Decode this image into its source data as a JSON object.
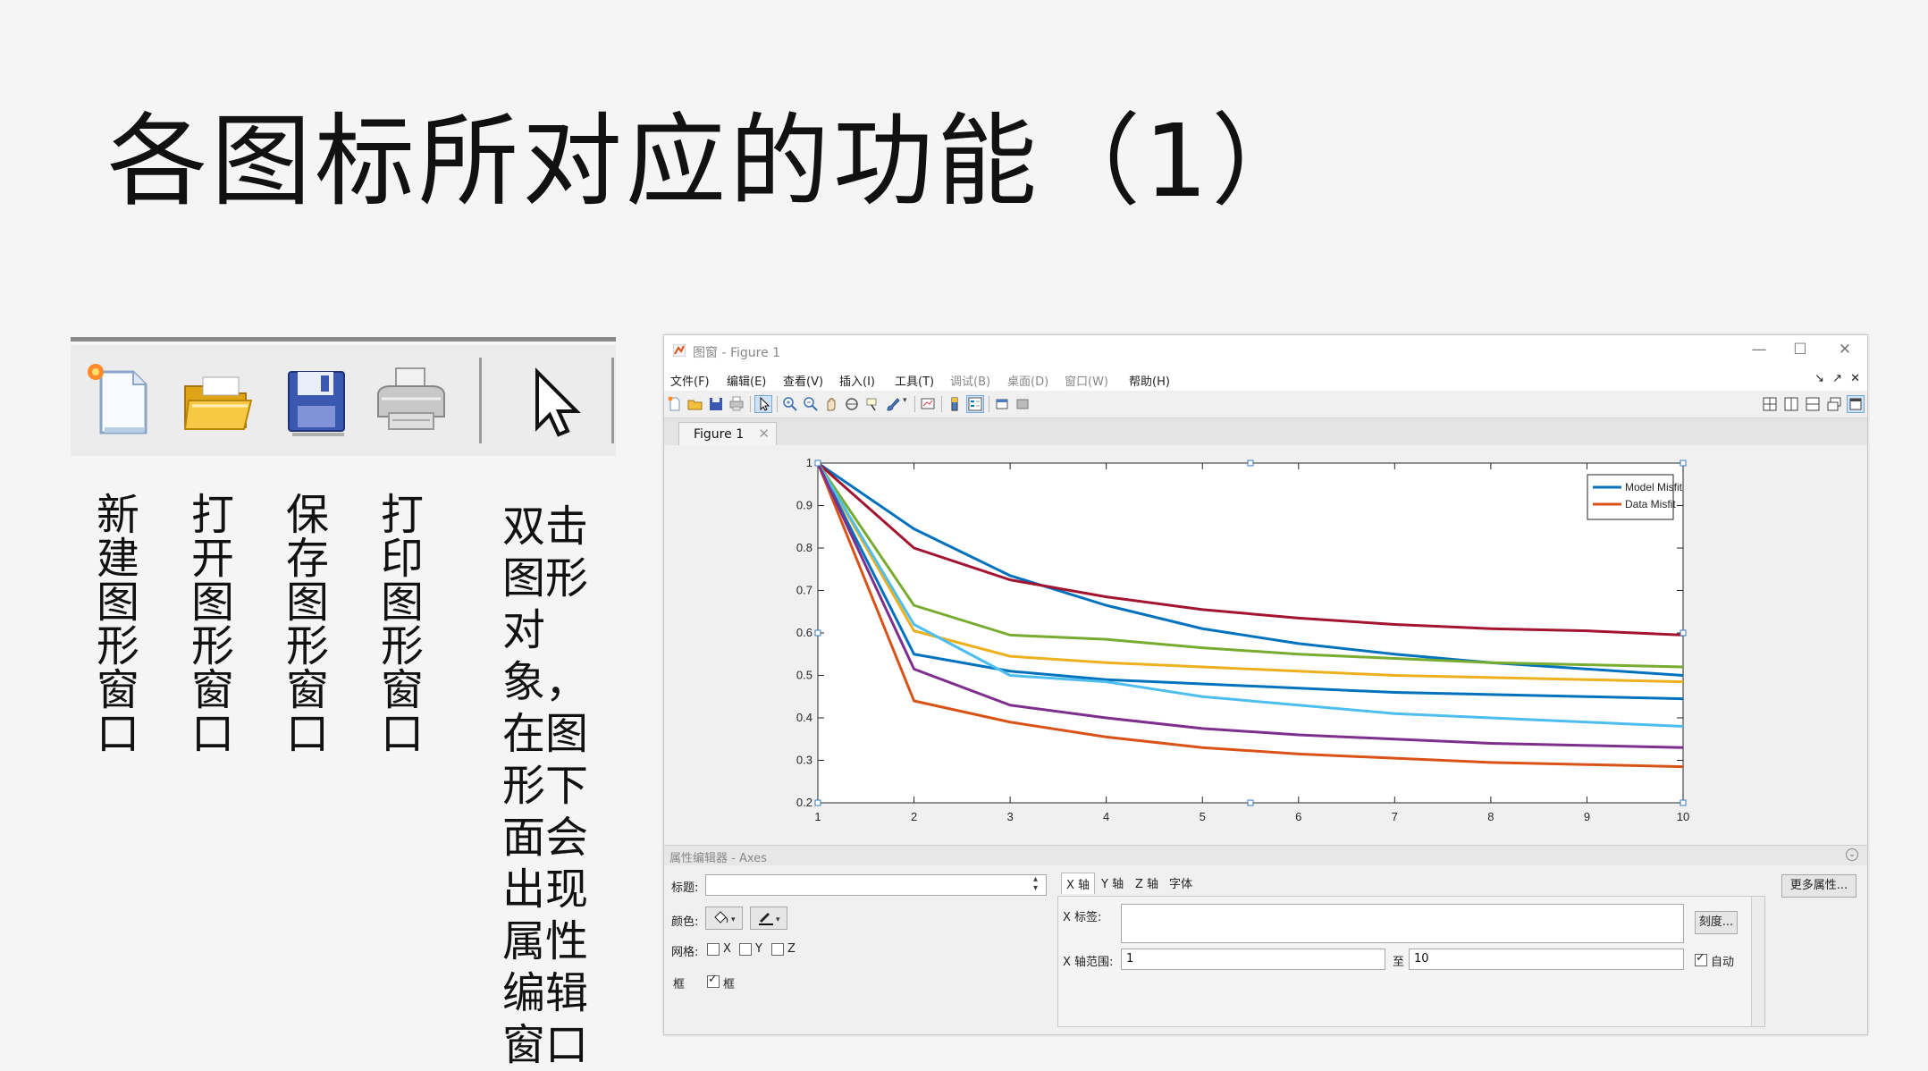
{
  "slide": {
    "title": "各图标所对应的功能（1）",
    "icon_captions": [
      "新建图形窗口",
      "打开图形窗口",
      "保存图形窗口",
      "打印图形窗口"
    ],
    "pointer_description": "双击图形对象，在图形下面会出现属性编辑窗口"
  },
  "big_toolbar": {
    "icons": [
      "new-figure-icon",
      "open-folder-icon",
      "save-floppy-icon",
      "printer-icon",
      "pointer-arrow-icon"
    ]
  },
  "figure_window": {
    "title": "图窗 - Figure 1",
    "window_controls": [
      "—",
      "☐",
      "✕"
    ],
    "menu": [
      "文件(F)",
      "编辑(E)",
      "查看(V)",
      "插入(I)",
      "工具(T)",
      "调试(B)",
      "桌面(D)",
      "窗口(W)",
      "帮助(H)"
    ],
    "menu_right_icons": [
      "↘",
      "↗",
      "✕"
    ],
    "tab_label": "Figure 1",
    "tab_close": "✕"
  },
  "colors": {
    "model_misfit": "#0072bd",
    "data_misfit": "#d95319",
    "yellow": "#edb120",
    "purple": "#7e2f8e",
    "green": "#77ac30",
    "lightblue": "#4dbeee",
    "darkred": "#a2142f"
  },
  "chart_data": {
    "type": "line",
    "x": [
      1,
      2,
      3,
      4,
      5,
      6,
      7,
      8,
      9,
      10
    ],
    "xlim": [
      1,
      10
    ],
    "ylim": [
      0.2,
      1
    ],
    "xticks": [
      1,
      2,
      3,
      4,
      5,
      6,
      7,
      8,
      9,
      10
    ],
    "yticks": [
      0.2,
      0.3,
      0.4,
      0.5,
      0.6,
      0.7,
      0.8,
      0.9,
      1
    ],
    "legend_position": "top-right",
    "grid": false,
    "series": [
      {
        "name": "Model Misfit",
        "color": "#0072bd",
        "values": [
          1,
          0.845,
          0.735,
          0.665,
          0.61,
          0.575,
          0.55,
          0.53,
          0.515,
          0.5
        ]
      },
      {
        "name": "Data Misfit",
        "color": "#d95319",
        "values": [
          1,
          0.44,
          0.39,
          0.355,
          0.33,
          0.315,
          0.305,
          0.295,
          0.29,
          0.285
        ]
      },
      {
        "color": "#a2142f",
        "values": [
          1,
          0.8,
          0.725,
          0.685,
          0.655,
          0.635,
          0.62,
          0.61,
          0.605,
          0.595
        ]
      },
      {
        "color": "#77ac30",
        "values": [
          1,
          0.665,
          0.595,
          0.585,
          0.565,
          0.55,
          0.54,
          0.53,
          0.525,
          0.52
        ]
      },
      {
        "color": "#edb120",
        "values": [
          1,
          0.605,
          0.545,
          0.53,
          0.52,
          0.51,
          0.5,
          0.495,
          0.49,
          0.485
        ]
      },
      {
        "color": "#0072bd",
        "values": [
          1,
          0.55,
          0.51,
          0.49,
          0.48,
          0.47,
          0.46,
          0.455,
          0.45,
          0.445
        ]
      },
      {
        "color": "#4dbeee",
        "values": [
          1,
          0.62,
          0.5,
          0.485,
          0.45,
          0.43,
          0.41,
          0.4,
          0.39,
          0.38
        ]
      },
      {
        "color": "#7e2f8e",
        "values": [
          1,
          0.515,
          0.43,
          0.4,
          0.375,
          0.36,
          0.35,
          0.34,
          0.335,
          0.33
        ]
      }
    ]
  },
  "property_editor": {
    "header": "属性编辑器 - Axes",
    "title_label": "标题:",
    "title_value": "",
    "color_label": "颜色:",
    "grid_label": "网格:",
    "grid_x": "X",
    "grid_y": "Y",
    "grid_z": "Z",
    "box_label": "框",
    "box_checkbox": "框",
    "tabs": [
      "X 轴",
      "Y 轴",
      "Z 轴",
      "字体"
    ],
    "xlabel_label": "X 标签:",
    "xlabel_value": "",
    "ticks_button": "刻度...",
    "xlim_label": "X 轴范围:",
    "xlim_from": "1",
    "xlim_to_label": "至",
    "xlim_to": "10",
    "auto_label": "自动",
    "more_props_button": "更多属性..."
  }
}
